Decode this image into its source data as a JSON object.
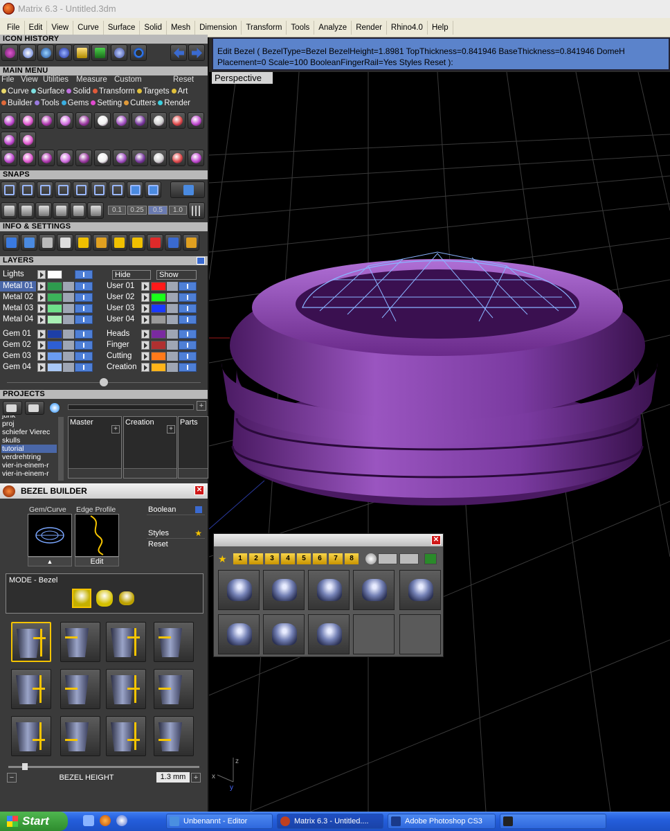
{
  "window": {
    "title": "Matrix 6.3 - Untitled.3dm"
  },
  "menubar": {
    "items": [
      "File",
      "Edit",
      "View",
      "Curve",
      "Surface",
      "Solid",
      "Mesh",
      "Dimension",
      "Transform",
      "Tools",
      "Analyze",
      "Render",
      "Rhino4.0",
      "Help"
    ]
  },
  "left": {
    "icon_history": "ICON HISTORY",
    "main_menu": {
      "title": "MAIN MENU",
      "submenu": [
        "File",
        "View",
        "Utilities",
        "Measure",
        "Custom"
      ],
      "reset": "Reset",
      "row1": [
        {
          "label": "Curve",
          "color": "#e8d86a"
        },
        {
          "label": "Surface",
          "color": "#7ddfe0"
        },
        {
          "label": "Solid",
          "color": "#c070e0"
        },
        {
          "label": "Transform",
          "color": "#e05a3a"
        },
        {
          "label": "Targets",
          "color": "#e0c03a"
        },
        {
          "label": "Art",
          "color": "#e0c03a"
        }
      ],
      "row2": [
        {
          "label": "Builder",
          "color": "#e06a3a"
        },
        {
          "label": "Tools",
          "color": "#9a7ae0"
        },
        {
          "label": "Gems",
          "color": "#3aaee0"
        },
        {
          "label": "Setting",
          "color": "#e04ad0"
        },
        {
          "label": "Cutters",
          "color": "#e09a3a"
        },
        {
          "label": "Render",
          "color": "#3ad0e0"
        }
      ]
    },
    "snaps": {
      "title": "SNAPS",
      "values": [
        "0.1",
        "0.25",
        "0.5",
        "1.0"
      ]
    },
    "info": {
      "title": "INFO & SETTINGS"
    },
    "layers": {
      "title": "LAYERS",
      "lights": "Lights",
      "hide": "Hide",
      "show": "Show",
      "left_col": [
        {
          "name": "Metal 01",
          "color": "#2e9a4e",
          "selected": true
        },
        {
          "name": "Metal 02",
          "color": "#3cb25a"
        },
        {
          "name": "Metal 03",
          "color": "#6ee08a"
        },
        {
          "name": "Metal 04",
          "color": "#a8f0b4"
        },
        {
          "name": "Gem 01",
          "color": "#1d3fa8"
        },
        {
          "name": "Gem 02",
          "color": "#2e5fd4"
        },
        {
          "name": "Gem 03",
          "color": "#6a9cf0"
        },
        {
          "name": "Gem 04",
          "color": "#a9c8f6"
        }
      ],
      "right_col": [
        {
          "name": "User 01",
          "color": "#ff1a1a"
        },
        {
          "name": "User 02",
          "color": "#1aff1a"
        },
        {
          "name": "User 03",
          "color": "#1a3aff"
        },
        {
          "name": "User 04",
          "color": "#9a9a9a"
        },
        {
          "name": "Heads",
          "color": "#7a2aa0"
        },
        {
          "name": "Finger",
          "color": "#b03030"
        },
        {
          "name": "Cutting",
          "color": "#ff7a1a"
        },
        {
          "name": "Creation",
          "color": "#ffb41a"
        }
      ]
    },
    "projects": {
      "title": "PROJECTS",
      "items": [
        "junk",
        "proj",
        "schiefer Vierec",
        "skulls",
        "tutorial",
        "verdrehtring",
        "vier-in-einem-r",
        "vier-in-einem-r"
      ],
      "selected": "tutorial",
      "boxes": [
        "Master",
        "Creation",
        "Parts"
      ]
    },
    "bezel": {
      "title": "BEZEL BUILDER",
      "gem_curve": "Gem/Curve",
      "edge_profile": "Edge Profile",
      "edit": "Edit",
      "boolean": "Boolean",
      "styles": "Styles",
      "reset": "Reset",
      "mode": "MODE - Bezel",
      "height_label": "BEZEL HEIGHT",
      "height_value": "1.3 mm"
    }
  },
  "command": {
    "line1": "Edit Bezel ( BezelType=Bezel  BezelHeight=1.8981  TopThickness=0.841946  BaseThickness=0.841946  DomeH",
    "line2": "Placement=0  Scale=100  BooleanFingerRail=Yes  Styles  Reset ):"
  },
  "viewport": {
    "label": "Perspective"
  },
  "styles_popup": {
    "tabs": [
      "1",
      "2",
      "3",
      "4",
      "5",
      "6",
      "7",
      "8"
    ]
  },
  "taskbar": {
    "start": "Start",
    "tasks": [
      {
        "label": "Unbenannt - Editor",
        "icon_color": "#4a8fe0"
      },
      {
        "label": "Matrix 6.3 - Untitled....",
        "icon_color": "#c04020"
      },
      {
        "label": "Adobe Photoshop CS3",
        "icon_color": "#1a3a8a"
      }
    ]
  }
}
